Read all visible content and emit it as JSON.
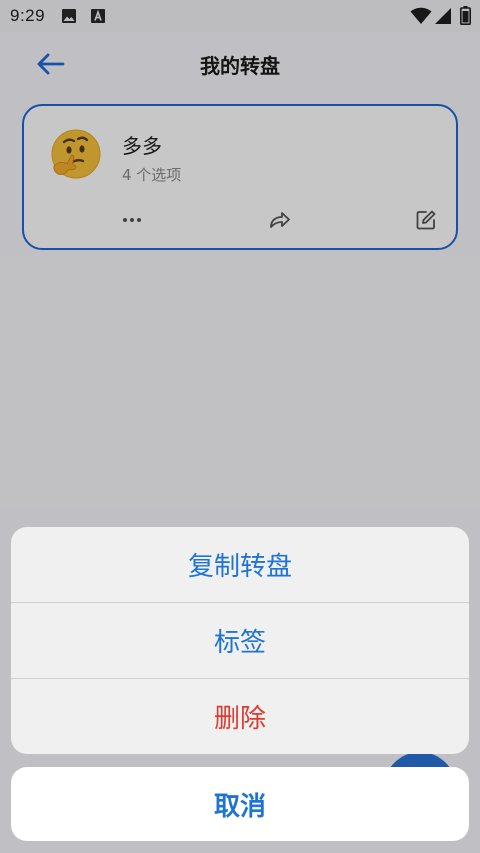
{
  "status_bar": {
    "time": "9:29",
    "icons": [
      "image-icon",
      "font-icon",
      "wifi-icon",
      "signal-icon",
      "battery-icon"
    ]
  },
  "app_bar": {
    "title": "我的转盘",
    "back_icon": "arrow-left-icon"
  },
  "wheel_card": {
    "emoji": "🤔",
    "name": "多多",
    "option_count": "4 个选项",
    "actions": [
      "more-icon",
      "share-icon",
      "edit-icon"
    ]
  },
  "action_sheet": {
    "items": [
      {
        "label": "复制转盘",
        "color": "#1f74d3"
      },
      {
        "label": "标签",
        "color": "#1f74d3"
      },
      {
        "label": "删除",
        "color": "#dd3b30"
      }
    ],
    "cancel_label": "取消"
  },
  "colors": {
    "accent": "#1f74d3",
    "danger": "#dd3b30",
    "card_border": "#1e68d8"
  }
}
